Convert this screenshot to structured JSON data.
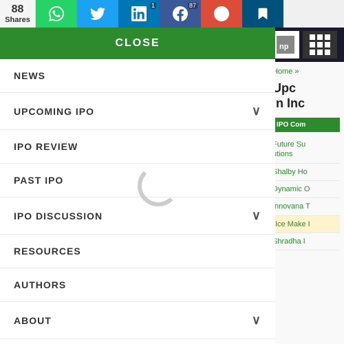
{
  "sharebar": {
    "count_label": "Shares",
    "count": "88",
    "buttons": [
      {
        "id": "whatsapp",
        "icon": "📱",
        "class": "whatsapp",
        "unicode": "W",
        "num": ""
      },
      {
        "id": "twitter",
        "icon": "🐦",
        "class": "twitter",
        "unicode": "t",
        "num": ""
      },
      {
        "id": "linkedin",
        "icon": "in",
        "class": "linkedin",
        "unicode": "in",
        "num": "1"
      },
      {
        "id": "facebook",
        "icon": "f",
        "class": "facebook",
        "unicode": "f",
        "num": "87"
      },
      {
        "id": "google",
        "icon": "G+",
        "class": "google",
        "unicode": "G+",
        "num": ""
      },
      {
        "id": "bookmark",
        "icon": "▶",
        "class": "bookmark",
        "unicode": "▶",
        "num": ""
      }
    ]
  },
  "sidebar": {
    "close_label": "CLOSE",
    "nav_items": [
      {
        "id": "news",
        "label": "NEWS",
        "has_arrow": false
      },
      {
        "id": "upcoming-ipo",
        "label": "UPCOMING IPO",
        "has_arrow": true
      },
      {
        "id": "ipo-review",
        "label": "IPO REVIEW",
        "has_arrow": false
      },
      {
        "id": "past-ipo",
        "label": "PAST IPO",
        "has_arrow": false
      },
      {
        "id": "ipo-discussion",
        "label": "IPO DISCUSSION",
        "has_arrow": true
      },
      {
        "id": "resources",
        "label": "RESOURCES",
        "has_arrow": false
      },
      {
        "id": "authors",
        "label": "AUTHORS",
        "has_arrow": false
      },
      {
        "id": "about",
        "label": "ABOUT",
        "has_arrow": true
      }
    ]
  },
  "content": {
    "breadcrumb_home": "Home",
    "breadcrumb_separator": " »",
    "page_title_part1": "Upc",
    "page_title_part2": "in Inc",
    "tab_label": "IPO Com",
    "links": [
      {
        "id": "future-sup",
        "text": "Future Su",
        "subtext": "utions"
      },
      {
        "id": "shalby-ho",
        "text": "Shalby Ho"
      },
      {
        "id": "dynamic-o",
        "text": "Dynamic O"
      },
      {
        "id": "innovana",
        "text": "Innovana T"
      },
      {
        "id": "ice-make",
        "text": "Ice Make I",
        "highlighted": true
      },
      {
        "id": "shradha",
        "text": "Shradha I"
      }
    ]
  }
}
